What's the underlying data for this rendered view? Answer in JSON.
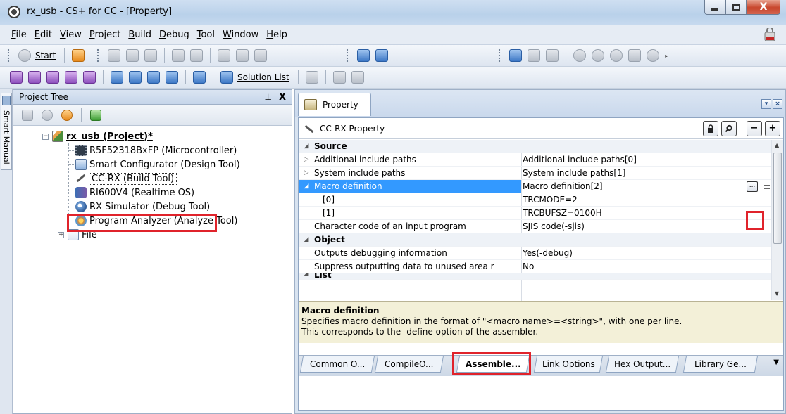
{
  "window": {
    "title": "rx_usb - CS+ for CC - [Property]",
    "close_glyph": "X"
  },
  "menu": [
    "File",
    "Edit",
    "View",
    "Project",
    "Build",
    "Debug",
    "Tool",
    "Window",
    "Help"
  ],
  "toolbar": {
    "start_label": "Start",
    "solution_list_label": "Solution List"
  },
  "side_strip": {
    "tab_label": "Smart Manual"
  },
  "project_tree": {
    "title": "Project Tree",
    "pin_glyph": "4",
    "close_glyph": "X",
    "nodes": [
      {
        "label": "rx_usb (Project)*",
        "icon": "project-icon"
      },
      {
        "label": "R5F52318BxFP (Microcontroller)",
        "icon": "chip-icon"
      },
      {
        "label": "Smart Configurator (Design Tool)",
        "icon": "config-icon"
      },
      {
        "label": "CC-RX (Build Tool)",
        "icon": "build-tool-icon"
      },
      {
        "label": "RI600V4 (Realtime OS)",
        "icon": "os-icon"
      },
      {
        "label": "RX Simulator (Debug Tool)",
        "icon": "simulator-icon"
      },
      {
        "label": "Program Analyzer (Analyze Tool)",
        "icon": "analyzer-icon"
      },
      {
        "label": "File",
        "icon": "file-icon"
      }
    ]
  },
  "property_panel": {
    "tab_label": "Property",
    "header": "CC-RX Property",
    "rows": [
      {
        "kind": "category",
        "name": "Source",
        "value": ""
      },
      {
        "kind": "item",
        "name": "Additional include paths",
        "value": "Additional include paths[0]"
      },
      {
        "kind": "item",
        "name": "System include paths",
        "value": "System include paths[1]"
      },
      {
        "kind": "item",
        "name": "Macro definition",
        "value": "Macro definition[2]"
      },
      {
        "kind": "child",
        "name": "[0]",
        "value": "TRCMODE=2"
      },
      {
        "kind": "child",
        "name": "[1]",
        "value": "TRCBUFSZ=0100H"
      },
      {
        "kind": "item",
        "name": "Character code of an input program",
        "value": "SJIS code(-sjis)"
      },
      {
        "kind": "category",
        "name": "Object",
        "value": ""
      },
      {
        "kind": "item",
        "name": "Outputs debugging information",
        "value": "Yes(-debug)"
      },
      {
        "kind": "item",
        "name": "Suppress outputting data to unused area r",
        "value": "No"
      },
      {
        "kind": "category",
        "name": "List",
        "value": ""
      }
    ],
    "ellipsis_label": "...",
    "description": {
      "title": "Macro definition",
      "line1": "Specifies macro definition in the format of \"<macro name>=<string>\", with one per line.",
      "line2": "This corresponds to the -define option of the assembler."
    },
    "bottom_tabs": [
      "Common O...",
      "CompileO...",
      "Assemble...",
      "Link Options",
      "Hex Output...",
      "Library Ge..."
    ],
    "active_tab": "Assemble..."
  },
  "colors": {
    "highlight_frame": "#e0232b",
    "selection": "#3399ff",
    "description_bg": "#f3f0d8"
  }
}
